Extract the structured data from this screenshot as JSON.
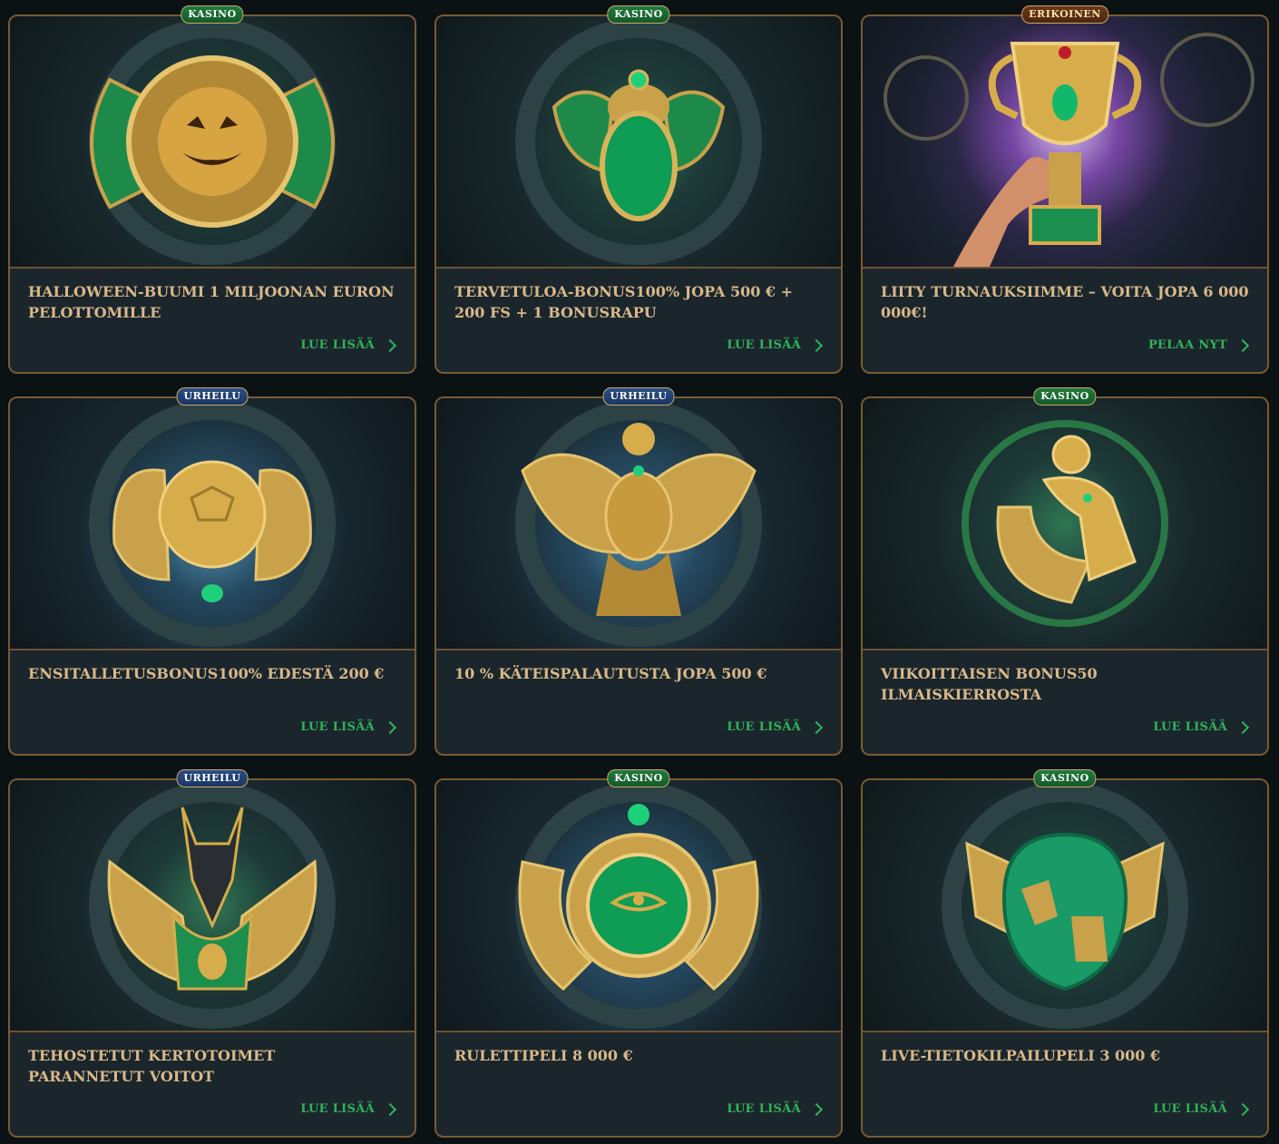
{
  "cards": [
    {
      "badge": "KASINO",
      "badge_type": "kasino",
      "title": "HALLOWEEN-BUUMI 1 MILJOONAN EURON PELOTTOMILLE",
      "cta": "LUE LISÄÄ",
      "icon": "pumpkin-medallion-icon",
      "glow": "green"
    },
    {
      "badge": "KASINO",
      "badge_type": "kasino",
      "title": "TERVETULOA-BONUS100% JOPA 500 € + 200 FS + 1 BONUSRAPU",
      "cta": "LUE LISÄÄ",
      "icon": "scarab-icon",
      "glow": "green"
    },
    {
      "badge": "ERIKOINEN",
      "badge_type": "erikoinen",
      "title": "LIITY TURNAUKSIIMME – VOITA JOPA 6 000 000€!",
      "cta": "PELAA NYT",
      "icon": "trophy-icon",
      "glow": "purple"
    },
    {
      "badge": "URHEILU",
      "badge_type": "urheilu",
      "title": "ENSITALLETUSBONUS100% EDESTÄ 200 €",
      "cta": "LUE LISÄÄ",
      "icon": "winged-ball-icon",
      "glow": "blue"
    },
    {
      "badge": "URHEILU",
      "badge_type": "urheilu",
      "title": "10 % KÄTEISPALAUTUSTA JOPA 500 €",
      "cta": "LUE LISÄÄ",
      "icon": "winged-goddess-icon",
      "glow": "blue"
    },
    {
      "badge": "KASINO",
      "badge_type": "kasino",
      "title": "VIIKOITTAISEN BONUS50 ILMAISKIERROSTA",
      "cta": "LUE LISÄÄ",
      "icon": "horus-falcon-icon",
      "glow": "green"
    },
    {
      "badge": "URHEILU",
      "badge_type": "urheilu",
      "title": "TEHOSTETUT KERTOTOIMET PARANNETUT VOITOT",
      "cta": "LUE LISÄÄ",
      "icon": "anubis-icon",
      "glow": "green"
    },
    {
      "badge": "KASINO",
      "badge_type": "kasino",
      "title": "RULETTIPELI 8 000 €",
      "cta": "LUE LISÄÄ",
      "icon": "eye-of-horus-icon",
      "glow": "green"
    },
    {
      "badge": "KASINO",
      "badge_type": "kasino",
      "title": "LIVE-TIETOKILPAILUPELI 3 000 €",
      "cta": "LUE LISÄÄ",
      "icon": "crocodile-icon",
      "glow": "green"
    }
  ]
}
